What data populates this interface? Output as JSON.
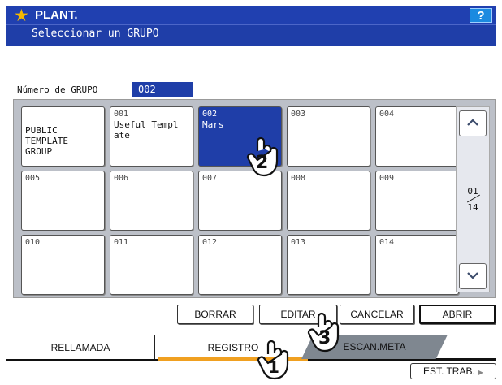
{
  "header": {
    "title": "PLANT.",
    "subtitle": "Seleccionar un GRUPO",
    "help_label": "?"
  },
  "group": {
    "label": "Número de GRUPO",
    "value": "002"
  },
  "tiles": [
    {
      "num": "",
      "name": "PUBLIC\nTEMPLATE\nGROUP"
    },
    {
      "num": "001",
      "name": "Useful Templ\nate"
    },
    {
      "num": "002",
      "name": "Mars"
    },
    {
      "num": "003",
      "name": ""
    },
    {
      "num": "004",
      "name": ""
    },
    {
      "num": "005",
      "name": ""
    },
    {
      "num": "006",
      "name": ""
    },
    {
      "num": "007",
      "name": ""
    },
    {
      "num": "008",
      "name": ""
    },
    {
      "num": "009",
      "name": ""
    },
    {
      "num": "010",
      "name": ""
    },
    {
      "num": "011",
      "name": ""
    },
    {
      "num": "012",
      "name": ""
    },
    {
      "num": "013",
      "name": ""
    },
    {
      "num": "014",
      "name": ""
    }
  ],
  "pager": {
    "current": "01",
    "total": "14"
  },
  "actions": {
    "delete": "BORRAR",
    "edit": "EDITAR",
    "cancel": "CANCELAR",
    "open": "ABRIR"
  },
  "tabs": {
    "recall": "RELLAMADA",
    "register": "REGISTRO",
    "scan_meta": "ESCAN.META"
  },
  "status": {
    "label": "EST. TRAB."
  },
  "steps": [
    "1",
    "2",
    "3"
  ],
  "colors": {
    "header_blue": "#1f3ea8",
    "selected_tile": "#1f3ea8",
    "help_button": "#1b8ae0",
    "active_tab_underline": "#f0a020",
    "star": "#f5b800"
  }
}
